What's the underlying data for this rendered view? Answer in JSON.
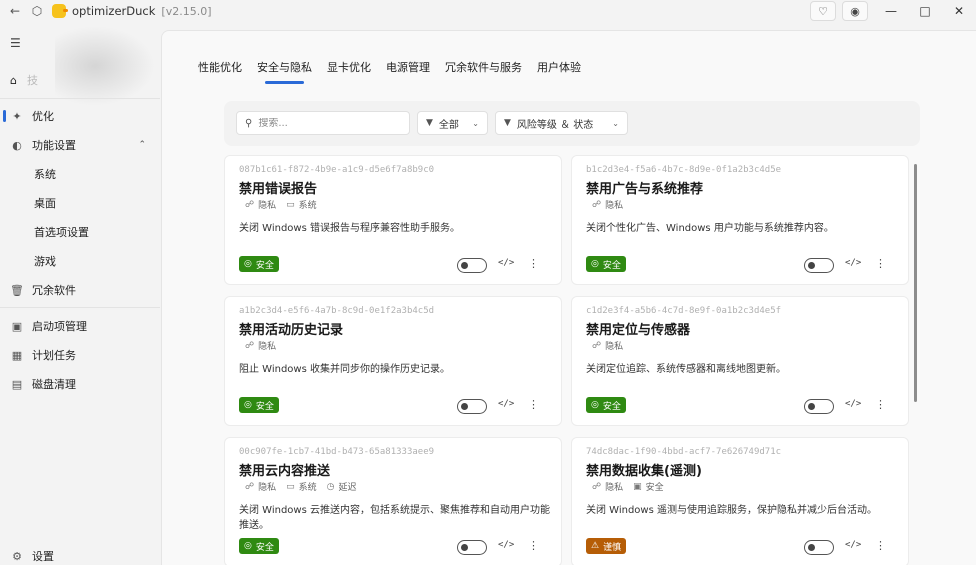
{
  "titlebar": {
    "title": "optimizerDuck",
    "version": "[v2.15.0]"
  },
  "sidebar": {
    "user_initial": "技",
    "items": [
      {
        "label": "优化",
        "icon": "wand-icon"
      },
      {
        "label": "功能设置",
        "icon": "toggle-icon"
      },
      {
        "label": "系统"
      },
      {
        "label": "桌面"
      },
      {
        "label": "首选项设置"
      },
      {
        "label": "游戏"
      },
      {
        "label": "冗余软件",
        "icon": "trash-icon"
      },
      {
        "label": "启动项管理",
        "icon": "startup-icon"
      },
      {
        "label": "计划任务",
        "icon": "calendar-icon"
      },
      {
        "label": "磁盘清理",
        "icon": "disk-icon"
      }
    ],
    "settings_label": "设置"
  },
  "tabs": [
    "性能优化",
    "安全与隐私",
    "显卡优化",
    "电源管理",
    "冗余软件与服务",
    "用户体验"
  ],
  "filters": {
    "search_placeholder": "搜索...",
    "category": "全部",
    "risk_status": "风险等级 ＆ 状态"
  },
  "cards": [
    {
      "id": "087b1c61-f872-4b9e-a1c9-d5e6f7a8b9c0",
      "title": "禁用错误报告",
      "tags": [
        "隐私",
        "系统"
      ],
      "description": "关闭 Windows 错误报告与程序兼容性助手服务。",
      "risk": "安全"
    },
    {
      "id": "b1c2d3e4-f5a6-4b7c-8d9e-0f1a2b3c4d5e",
      "title": "禁用广告与系统推荐",
      "tags": [
        "隐私"
      ],
      "description": "关闭个性化广告、Windows 用户功能与系统推荐内容。",
      "risk": "安全"
    },
    {
      "id": "a1b2c3d4-e5f6-4a7b-8c9d-0e1f2a3b4c5d",
      "title": "禁用活动历史记录",
      "tags": [
        "隐私"
      ],
      "description": "阻止 Windows 收集并同步你的操作历史记录。",
      "risk": "安全"
    },
    {
      "id": "c1d2e3f4-a5b6-4c7d-8e9f-0a1b2c3d4e5f",
      "title": "禁用定位与传感器",
      "tags": [
        "隐私"
      ],
      "description": "关闭定位追踪、系统传感器和离线地图更新。",
      "risk": "安全"
    },
    {
      "id": "00c907fe-1cb7-41bd-b473-65a81333aee9",
      "title": "禁用云内容推送",
      "tags": [
        "隐私",
        "系统",
        "延迟"
      ],
      "description": "关闭 Windows 云推送内容，包括系统提示、聚焦推荐和自动用户功能推送。",
      "risk": "安全"
    },
    {
      "id": "74dc8dac-1f90-4bbd-acf7-7e626749d71c",
      "title": "禁用数据收集(遥测)",
      "tags": [
        "隐私",
        "安全"
      ],
      "description": "关闭 Windows 遥测与使用追踪服务，保护隐私并减少后台活动。",
      "risk": "谨慎"
    }
  ],
  "colors": {
    "accent": "#2a6ad7",
    "safe": "#2f8a12",
    "caution": "#b65d06"
  }
}
